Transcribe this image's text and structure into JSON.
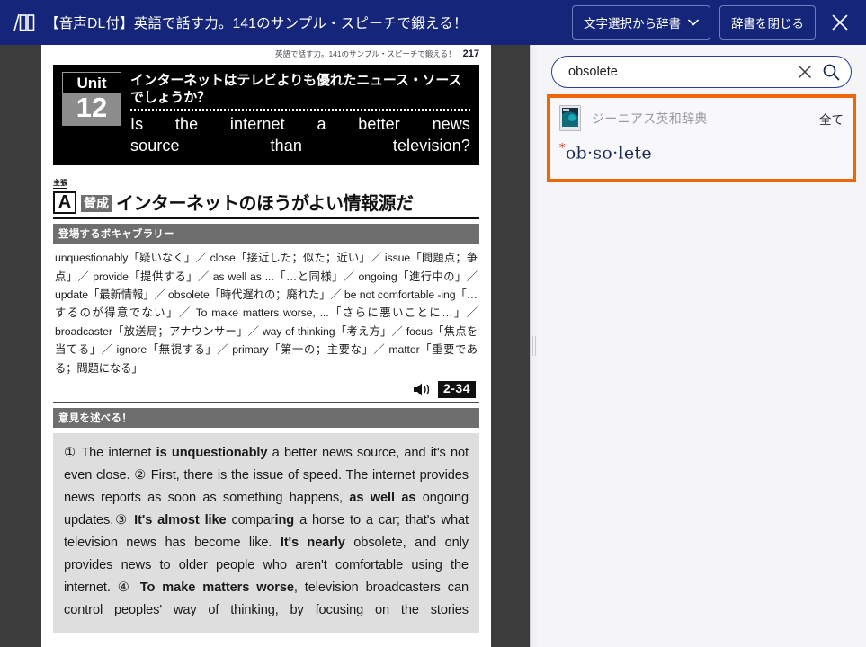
{
  "header": {
    "logo_icon": "book-logo-icon",
    "title": "【音声DL付】英語で話す力。141のサンプル・スピーチで鍛える！",
    "dict_select_button": "文字選択から辞書",
    "dict_select_caret": "chevron-down-icon",
    "close_dict_button": "辞書を閉じる",
    "close_icon": "close-icon",
    "bg_color": "#15267a"
  },
  "reader": {
    "page": {
      "running_head": "英語で話す力。141のサンプル・スピーチで鍛える！",
      "folio": "217",
      "unit_label": "Unit",
      "unit_number": "12",
      "title_jp": "インターネットはテレビよりも優れたニュース・ソースでしょうか？",
      "title_en_line1": "Is the internet a better news",
      "title_en_line2": "source than television?",
      "claim_label": "主張",
      "claim_letter": "A",
      "claim_tag": "賛成",
      "claim_text": "インターネットのほうがよい情報源だ",
      "vocab_heading": "登場するボキャブラリー",
      "vocab_text": "unquestionably「疑いなく」／ close「接近した；似た；近い」／ issue「問題点；争点」／ provide「提供する」／ as well as ...「…と同様」／ ongoing「進行中の」／ update「最新情報」／ obsolete「時代遅れの；廃れた」／ be not comfortable -ing「…するのが得意でない」／ To make matters worse, ...「さらに悪いことに…」／ broadcaster「放送局；アナウンサー」／ way of thinking「考え方」／ focus「焦点を当てる」／ ignore「無視する」／ primary「第一の；主要な」／ matter「重要である；問題になる」",
      "audio_icon": "speaker-icon",
      "audio_track": "2-34",
      "opinion_heading": "意見を述べる！",
      "body_html": "① The internet <b>is unquestionably</b> a better news source, and it's not even close. ② First, there is the issue of speed. The internet provides news reports as soon as something happens, <b>as well as</b> ongoing updates.③ <b>It's almost like</b> compar<b>ing</b> a horse to a car; that's what television news has become like. <b>It's nearly</b> obsolete, and only provides news to older people who aren't comfortable using the internet. ④ <b>To make matters worse</b>, television broadcasters can control peoples' way of thinking, by focusing on the stories"
    }
  },
  "splitter": {
    "handle_icon": "drag-handle-icon"
  },
  "dictionary": {
    "search": {
      "value": "obsolete",
      "placeholder": "",
      "clear_icon": "clear-icon",
      "search_icon": "search-icon",
      "border_color": "#2a3c96"
    },
    "result": {
      "highlight_color": "#ef6606",
      "dict_icon": "dictionary-book-icon",
      "dict_name": "ジーニアス英和辞典",
      "show_all_label": "全て",
      "entry_marker": "*",
      "entry_word": "ob·so·lete"
    }
  }
}
